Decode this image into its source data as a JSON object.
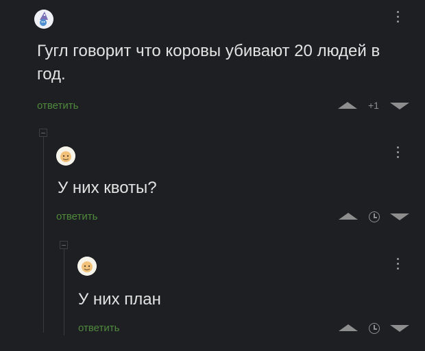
{
  "comments": [
    {
      "text_line1": "Гугл говорит что коровы убивают 20 людей в",
      "text_line2": "год.",
      "reply_label": "ответить",
      "score": "+1"
    },
    {
      "text_line1": "У них квоты?",
      "reply_label": "ответить"
    },
    {
      "text_line1": "У них план",
      "reply_label": "ответить"
    }
  ],
  "colors": {
    "background": "#1e1f22",
    "reply_link": "#4f8a3c",
    "text": "#e3e3e3",
    "icon": "#8e8e8e"
  },
  "icons": {
    "menu": "kebab-menu-icon",
    "upvote": "triangle-up-icon",
    "downvote": "triangle-down-icon",
    "time": "clock-icon",
    "collapse": "collapse-minus-icon"
  }
}
